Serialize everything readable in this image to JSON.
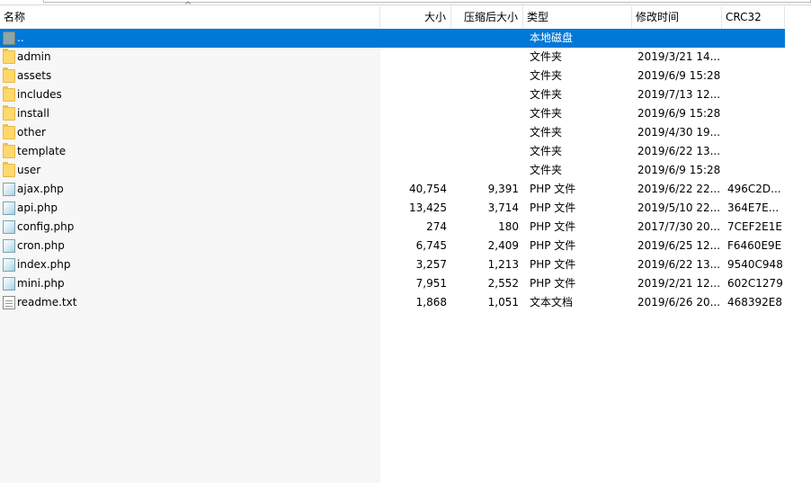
{
  "columns": {
    "name": "名称",
    "size": "大小",
    "packed": "压缩后大小",
    "type": "类型",
    "modified": "修改时间",
    "crc": "CRC32"
  },
  "rows": [
    {
      "name": "..",
      "size": "",
      "packed": "",
      "type": "本地磁盘",
      "modified": "",
      "crc": "",
      "icon": "parent-folder-icon",
      "selected": true
    },
    {
      "name": "admin",
      "size": "",
      "packed": "",
      "type": "文件夹",
      "modified": "2019/3/21 14...",
      "crc": "",
      "icon": "folder-icon"
    },
    {
      "name": "assets",
      "size": "",
      "packed": "",
      "type": "文件夹",
      "modified": "2019/6/9 15:28",
      "crc": "",
      "icon": "folder-icon"
    },
    {
      "name": "includes",
      "size": "",
      "packed": "",
      "type": "文件夹",
      "modified": "2019/7/13 12...",
      "crc": "",
      "icon": "folder-icon"
    },
    {
      "name": "install",
      "size": "",
      "packed": "",
      "type": "文件夹",
      "modified": "2019/6/9 15:28",
      "crc": "",
      "icon": "folder-icon"
    },
    {
      "name": "other",
      "size": "",
      "packed": "",
      "type": "文件夹",
      "modified": "2019/4/30 19...",
      "crc": "",
      "icon": "folder-icon"
    },
    {
      "name": "template",
      "size": "",
      "packed": "",
      "type": "文件夹",
      "modified": "2019/6/22 13...",
      "crc": "",
      "icon": "folder-icon"
    },
    {
      "name": "user",
      "size": "",
      "packed": "",
      "type": "文件夹",
      "modified": "2019/6/9 15:28",
      "crc": "",
      "icon": "folder-icon"
    },
    {
      "name": "ajax.php",
      "size": "40,754",
      "packed": "9,391",
      "type": "PHP 文件",
      "modified": "2019/6/22 22...",
      "crc": "496C2D...",
      "icon": "php-file-icon"
    },
    {
      "name": "api.php",
      "size": "13,425",
      "packed": "3,714",
      "type": "PHP 文件",
      "modified": "2019/5/10 22...",
      "crc": "364E7E...",
      "icon": "php-file-icon"
    },
    {
      "name": "config.php",
      "size": "274",
      "packed": "180",
      "type": "PHP 文件",
      "modified": "2017/7/30 20...",
      "crc": "7CEF2E1E",
      "icon": "php-file-icon"
    },
    {
      "name": "cron.php",
      "size": "6,745",
      "packed": "2,409",
      "type": "PHP 文件",
      "modified": "2019/6/25 12...",
      "crc": "F6460E9E",
      "icon": "php-file-icon"
    },
    {
      "name": "index.php",
      "size": "3,257",
      "packed": "1,213",
      "type": "PHP 文件",
      "modified": "2019/6/22 13...",
      "crc": "9540C948",
      "icon": "php-file-icon"
    },
    {
      "name": "mini.php",
      "size": "7,951",
      "packed": "2,552",
      "type": "PHP 文件",
      "modified": "2019/2/21 12...",
      "crc": "602C1279",
      "icon": "php-file-icon"
    },
    {
      "name": "readme.txt",
      "size": "1,868",
      "packed": "1,051",
      "type": "文本文档",
      "modified": "2019/6/26 20...",
      "crc": "468392E8",
      "icon": "txt-file-icon"
    }
  ],
  "colors": {
    "selection": "#0078d7",
    "name_column_bg": "#f7f7f7"
  }
}
